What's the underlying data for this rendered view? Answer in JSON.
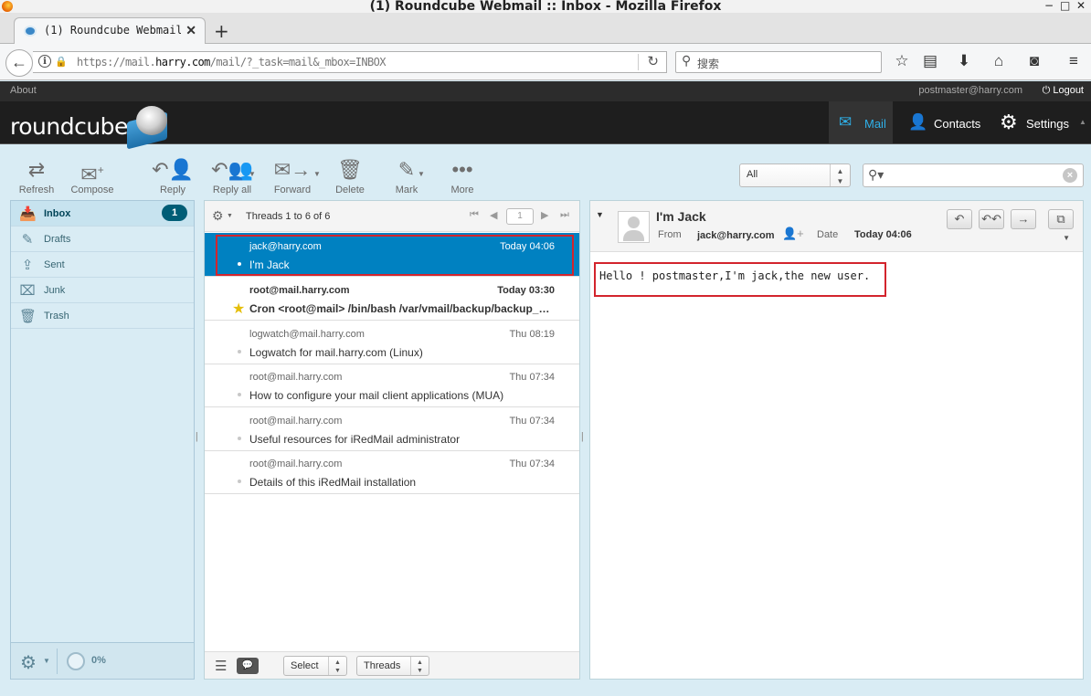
{
  "browser": {
    "window_title": "(1) Roundcube Webmail :: Inbox - Mozilla Firefox",
    "window_controls": [
      "−",
      "□",
      "✕"
    ],
    "tab_title": "(1) Roundcube Webmail :···",
    "new_tab": "+",
    "url_prefix": "https://mail.",
    "url_domain": "harry.com",
    "url_suffix": "/mail/?_task=mail&_mbox=INBOX",
    "search_placeholder": "搜索"
  },
  "topline": {
    "about": "About",
    "user_email": "postmaster@harry.com",
    "logout": "Logout"
  },
  "header": {
    "logo_text": "roundcube",
    "nav": [
      {
        "label": "Mail",
        "icon": "mail-icon",
        "active": true
      },
      {
        "label": "Contacts",
        "icon": "contacts-icon"
      },
      {
        "label": "Settings",
        "icon": "settings-icon"
      }
    ]
  },
  "toolbar": {
    "refresh": "Refresh",
    "compose": "Compose",
    "reply": "Reply",
    "reply_all": "Reply all",
    "forward": "Forward",
    "delete": "Delete",
    "mark": "Mark",
    "more": "More",
    "filter_value": "All"
  },
  "folders": [
    {
      "name": "Inbox",
      "icon": "inbox-icon",
      "unread": "1",
      "selected": true
    },
    {
      "name": "Drafts",
      "icon": "drafts-icon"
    },
    {
      "name": "Sent",
      "icon": "sent-icon"
    },
    {
      "name": "Junk",
      "icon": "junk-icon"
    },
    {
      "name": "Trash",
      "icon": "trash-icon"
    }
  ],
  "quota": "0%",
  "message_list": {
    "count_text": "Threads 1 to 6 of 6",
    "page": "1",
    "select_label": "Select",
    "threads_label": "Threads",
    "messages": [
      {
        "from": "jack@harry.com",
        "date": "Today 04:06",
        "subject": "I'm Jack",
        "selected": true
      },
      {
        "from": "root@mail.harry.com",
        "date": "Today 03:30",
        "subject": "Cron <root@mail> /bin/bash /var/vmail/backup/backup_mysql.sh",
        "unread": true,
        "flagged": true
      },
      {
        "from": "logwatch@mail.harry.com",
        "date": "Thu 08:19",
        "subject": "Logwatch for mail.harry.com (Linux)"
      },
      {
        "from": "root@mail.harry.com",
        "date": "Thu 07:34",
        "subject": "How to configure your mail client applications (MUA)"
      },
      {
        "from": "root@mail.harry.com",
        "date": "Thu 07:34",
        "subject": "Useful resources for iRedMail administrator"
      },
      {
        "from": "root@mail.harry.com",
        "date": "Thu 07:34",
        "subject": "Details of this iRedMail installation"
      }
    ]
  },
  "preview": {
    "subject": "I'm Jack",
    "from_label": "From",
    "from_value": "jack@harry.com",
    "date_label": "Date",
    "date_value": "Today 04:06",
    "body": "Hello ! postmaster,I'm jack,the new user."
  },
  "colors": {
    "accent": "#0081c1",
    "highlight_box": "#d3242d",
    "header_bg": "#1e1e1e",
    "active_nav": "#2fb0e8",
    "unread_badge": "#005d76"
  }
}
